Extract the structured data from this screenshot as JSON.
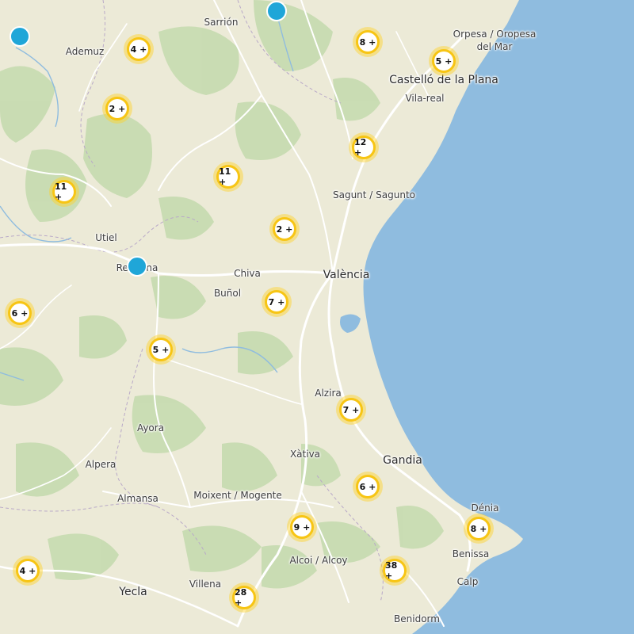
{
  "colors": {
    "land": "#ecead7",
    "sea": "#8fbcdf",
    "green": "#c6dbb0",
    "road": "#ffffff",
    "cluster_ring": "#f7c514",
    "pin": "#1fa6d8"
  },
  "places": {
    "sarrion": "Sarrión",
    "ademuz": "Ademuz",
    "oropesa_1": "Orpesa / Oropesa",
    "oropesa_2": "del Mar",
    "castello": "Castelló de la Plana",
    "vilareal": "Vila-real",
    "sagunt": "Sagunt / Sagunto",
    "utiel": "Utiel",
    "requena": "Requena",
    "chiva": "Chiva",
    "valencia": "València",
    "bunol": "Buñol",
    "alzira": "Alzira",
    "ayora": "Ayora",
    "xativa": "Xàtiva",
    "gandia": "Gandia",
    "alpera": "Alpera",
    "almansa": "Almansa",
    "moixent": "Moixent / Mogente",
    "denia": "Dénia",
    "benissa": "Benissa",
    "alcoi": "Alcoi / Alcoy",
    "calp": "Calp",
    "yecla": "Yecla",
    "villena": "Villena",
    "benidorm": "Benidorm"
  },
  "clusters": [
    {
      "id": "ademuz",
      "label": "4 +"
    },
    {
      "id": "northeast",
      "label": "8 +"
    },
    {
      "id": "castello",
      "label": "5 +"
    },
    {
      "id": "north",
      "label": "2 +"
    },
    {
      "id": "vilareal",
      "label": "12 +"
    },
    {
      "id": "west",
      "label": "11 +"
    },
    {
      "id": "center",
      "label": "11 +"
    },
    {
      "id": "chiva",
      "label": "2 +"
    },
    {
      "id": "far-west",
      "label": "6 +"
    },
    {
      "id": "bunol",
      "label": "7 +"
    },
    {
      "id": "requena-south",
      "label": "5 +"
    },
    {
      "id": "alzira",
      "label": "7 +"
    },
    {
      "id": "gandia",
      "label": "6 +"
    },
    {
      "id": "denia",
      "label": "8 +"
    },
    {
      "id": "alcoi",
      "label": "9 +"
    },
    {
      "id": "benissa",
      "label": "38 +"
    },
    {
      "id": "yecla-west",
      "label": "4 +"
    },
    {
      "id": "villena",
      "label": "28 +"
    }
  ]
}
